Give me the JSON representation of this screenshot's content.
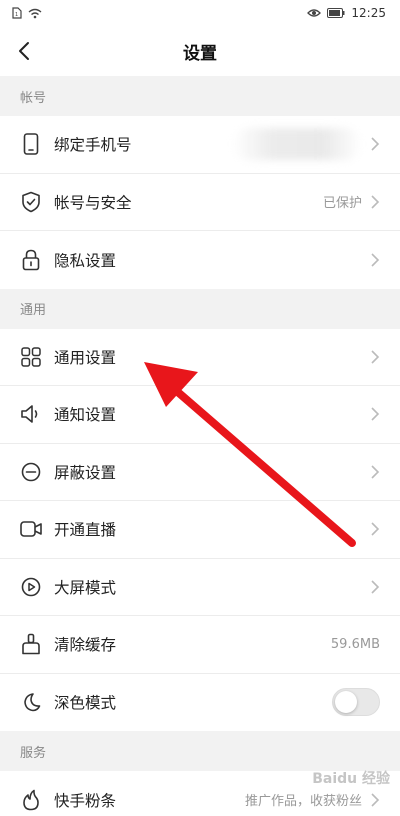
{
  "status": {
    "time": "12:25"
  },
  "header": {
    "title": "设置"
  },
  "sections": {
    "account": {
      "header": "帐号",
      "items": [
        {
          "label": "绑定手机号",
          "value": "",
          "icon": "phone-icon"
        },
        {
          "label": "帐号与安全",
          "value": "已保护",
          "icon": "shield-icon"
        },
        {
          "label": "隐私设置",
          "value": "",
          "icon": "lock-icon"
        }
      ]
    },
    "general": {
      "header": "通用",
      "items": [
        {
          "label": "通用设置",
          "value": "",
          "icon": "grid-icon"
        },
        {
          "label": "通知设置",
          "value": "",
          "icon": "speaker-icon"
        },
        {
          "label": "屏蔽设置",
          "value": "",
          "icon": "block-icon"
        },
        {
          "label": "开通直播",
          "value": "",
          "icon": "video-camera-icon"
        },
        {
          "label": "大屏模式",
          "value": "",
          "icon": "play-icon"
        },
        {
          "label": "清除缓存",
          "value": "59.6MB",
          "icon": "broom-icon"
        },
        {
          "label": "深色模式",
          "value": "",
          "icon": "moon-icon",
          "toggle_on": false
        }
      ]
    },
    "services": {
      "header": "服务",
      "items": [
        {
          "label": "快手粉条",
          "value": "推广作品，收获粉丝",
          "icon": "fire-icon"
        }
      ]
    }
  },
  "annotation": {
    "color": "#e8161b",
    "pointing_to": "通用设置"
  },
  "watermark": "Baidu 经验",
  "colors": {
    "chevron": "#bbbbbb",
    "icon": "#333333"
  }
}
